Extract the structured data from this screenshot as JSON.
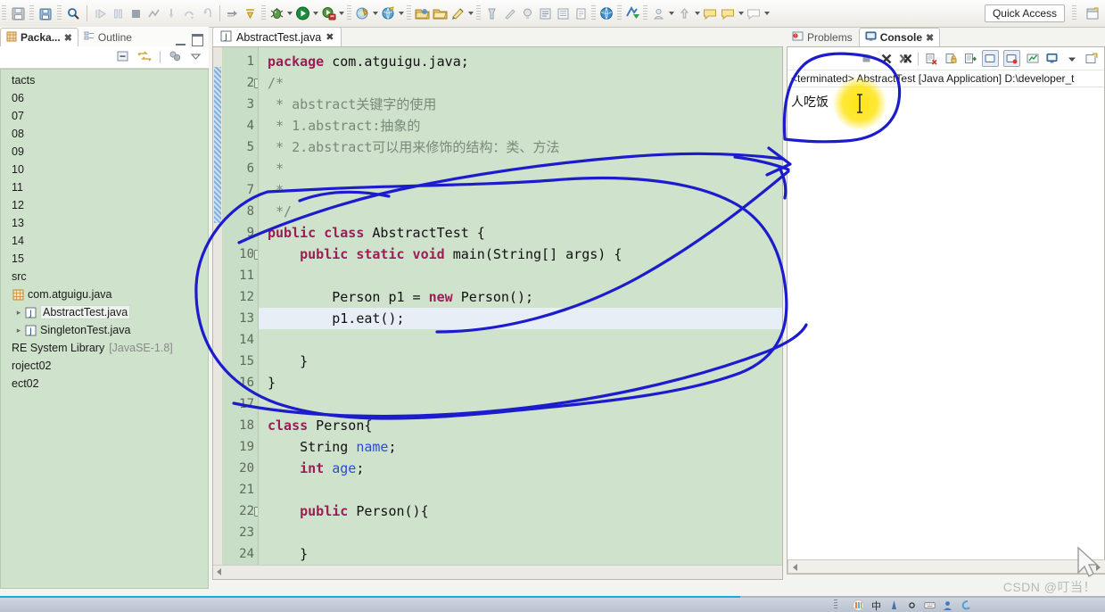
{
  "toolbar": {
    "quick_access_label": "Quick Access",
    "items": [
      {
        "name": "save-icon",
        "glyph": "▤"
      },
      {
        "name": "save-all-icon",
        "glyph": "▥"
      },
      {
        "name": "search-icon",
        "glyph": "⌕"
      },
      {
        "name": "resume-icon",
        "glyph": "▷"
      },
      {
        "name": "suspend-icon",
        "glyph": "‖"
      },
      {
        "name": "terminate-icon",
        "glyph": "■"
      },
      {
        "name": "disconnect-icon",
        "glyph": "⤨"
      },
      {
        "name": "step-into-icon",
        "glyph": "↓"
      },
      {
        "name": "step-over-icon",
        "glyph": "↷"
      },
      {
        "name": "step-return-icon",
        "glyph": "↰"
      },
      {
        "name": "next-annotation-icon",
        "glyph": "↦"
      },
      {
        "name": "previous-annotation-icon",
        "glyph": "↤"
      },
      {
        "name": "debug-icon",
        "glyph": "⚙"
      },
      {
        "name": "run-icon",
        "glyph": "▶"
      },
      {
        "name": "coverage-icon",
        "glyph": "◉"
      },
      {
        "name": "external-tools-icon",
        "glyph": "◔"
      },
      {
        "name": "search-globe-icon",
        "glyph": "○"
      },
      {
        "name": "open-type-icon",
        "glyph": "☰"
      },
      {
        "name": "open-task-icon",
        "glyph": "▱"
      },
      {
        "name": "new-java-project-icon",
        "glyph": "◪"
      },
      {
        "name": "new-package-icon",
        "glyph": "◫"
      },
      {
        "name": "new-class-icon",
        "glyph": "◬"
      },
      {
        "name": "javadoc-icon",
        "glyph": "ⓘ"
      },
      {
        "name": "browser-icon",
        "glyph": "●"
      },
      {
        "name": "perspective-icon",
        "glyph": "❖"
      },
      {
        "name": "back-icon",
        "glyph": "⇦"
      },
      {
        "name": "forward-icon",
        "glyph": "⇨"
      },
      {
        "name": "pin-icon",
        "glyph": "⚐"
      }
    ]
  },
  "sidebar": {
    "tab_active": "Packa...",
    "tab_inactive": "Outline",
    "close_glyph": "✖",
    "toolbar_icons": [
      "collapse-all-icon",
      "link-with-editor-icon",
      "view-menu-icon",
      "view-dropdown-icon"
    ],
    "tree": [
      {
        "label": "tacts",
        "indent": 0,
        "icon": "",
        "twist": ""
      },
      {
        "label": "06",
        "indent": 0,
        "icon": "",
        "twist": ""
      },
      {
        "label": "07",
        "indent": 0,
        "icon": "",
        "twist": ""
      },
      {
        "label": "08",
        "indent": 0,
        "icon": "",
        "twist": ""
      },
      {
        "label": "09",
        "indent": 0,
        "icon": "",
        "twist": ""
      },
      {
        "label": "10",
        "indent": 0,
        "icon": "",
        "twist": ""
      },
      {
        "label": "11",
        "indent": 0,
        "icon": "",
        "twist": ""
      },
      {
        "label": "12",
        "indent": 0,
        "icon": "",
        "twist": ""
      },
      {
        "label": "13",
        "indent": 0,
        "icon": "",
        "twist": ""
      },
      {
        "label": "14",
        "indent": 0,
        "icon": "",
        "twist": ""
      },
      {
        "label": "15",
        "indent": 0,
        "icon": "",
        "twist": ""
      },
      {
        "label": "src",
        "indent": 0,
        "icon": "",
        "twist": ""
      },
      {
        "label": "com.atguigu.java",
        "indent": 0,
        "icon": "package-icon",
        "twist": ""
      },
      {
        "label": "AbstractTest.java",
        "indent": 1,
        "icon": "java-file-icon",
        "twist": "▸",
        "selected": true
      },
      {
        "label": "SingletonTest.java",
        "indent": 1,
        "icon": "java-file-icon",
        "twist": "▸"
      },
      {
        "label": "RE System Library",
        "indent": 0,
        "icon": "",
        "twist": "",
        "dim": "[JavaSE-1.8]"
      },
      {
        "label": "roject02",
        "indent": 0,
        "icon": "",
        "twist": ""
      },
      {
        "label": "ect02",
        "indent": 0,
        "icon": "",
        "twist": ""
      }
    ]
  },
  "editor": {
    "tab_title": "AbstractTest.java",
    "tab_icon": "java-file-icon",
    "close_glyph": "✖",
    "lines": [
      {
        "n": "1",
        "fold": "",
        "tokens": [
          {
            "t": "package",
            "c": "kw"
          },
          {
            "t": " com.atguigu.java;",
            "c": "pln"
          }
        ]
      },
      {
        "n": "2",
        "fold": "-",
        "tokens": [
          {
            "t": "/*",
            "c": "cmt"
          }
        ]
      },
      {
        "n": "3",
        "fold": "",
        "tokens": [
          {
            "t": " * abstract关键字的使用",
            "c": "cmt"
          }
        ]
      },
      {
        "n": "4",
        "fold": "",
        "tokens": [
          {
            "t": " * 1.abstract:抽象的",
            "c": "cmt"
          }
        ]
      },
      {
        "n": "5",
        "fold": "",
        "tokens": [
          {
            "t": " * 2.abstract可以用来修饰的结构：类、方法",
            "c": "cmt"
          }
        ]
      },
      {
        "n": "6",
        "fold": "",
        "tokens": [
          {
            "t": " *",
            "c": "cmt"
          }
        ]
      },
      {
        "n": "7",
        "fold": "",
        "tokens": [
          {
            "t": " *",
            "c": "cmt"
          }
        ]
      },
      {
        "n": "8",
        "fold": "",
        "tokens": [
          {
            "t": " */",
            "c": "cmt"
          }
        ]
      },
      {
        "n": "9",
        "fold": "",
        "tokens": [
          {
            "t": "public class",
            "c": "kw"
          },
          {
            "t": " AbstractTest {",
            "c": "pln"
          }
        ]
      },
      {
        "n": "10",
        "fold": "-",
        "tokens": [
          {
            "t": "    ",
            "c": "pln"
          },
          {
            "t": "public static void",
            "c": "kw"
          },
          {
            "t": " main(String[] args) {",
            "c": "pln"
          }
        ]
      },
      {
        "n": "11",
        "fold": "",
        "tokens": [
          {
            "t": "",
            "c": "pln"
          }
        ]
      },
      {
        "n": "12",
        "fold": "",
        "tokens": [
          {
            "t": "        Person p1 = ",
            "c": "pln"
          },
          {
            "t": "new",
            "c": "kw"
          },
          {
            "t": " Person();",
            "c": "pln"
          }
        ]
      },
      {
        "n": "13",
        "fold": "",
        "highlight": true,
        "tokens": [
          {
            "t": "        p1.eat();",
            "c": "pln"
          }
        ]
      },
      {
        "n": "14",
        "fold": "",
        "tokens": [
          {
            "t": "",
            "c": "pln"
          }
        ]
      },
      {
        "n": "15",
        "fold": "",
        "tokens": [
          {
            "t": "    }",
            "c": "pln"
          }
        ]
      },
      {
        "n": "16",
        "fold": "",
        "tokens": [
          {
            "t": "}",
            "c": "pln"
          }
        ]
      },
      {
        "n": "17",
        "fold": "",
        "tokens": [
          {
            "t": "",
            "c": "pln"
          }
        ]
      },
      {
        "n": "18",
        "fold": "",
        "tokens": [
          {
            "t": "class",
            "c": "kw"
          },
          {
            "t": " Person{",
            "c": "pln"
          }
        ]
      },
      {
        "n": "19",
        "fold": "",
        "tokens": [
          {
            "t": "    String ",
            "c": "pln"
          },
          {
            "t": "name",
            "c": "fld"
          },
          {
            "t": ";",
            "c": "pln"
          }
        ]
      },
      {
        "n": "20",
        "fold": "",
        "tokens": [
          {
            "t": "    ",
            "c": "pln"
          },
          {
            "t": "int",
            "c": "kw"
          },
          {
            "t": " ",
            "c": "pln"
          },
          {
            "t": "age",
            "c": "fld"
          },
          {
            "t": ";",
            "c": "pln"
          }
        ]
      },
      {
        "n": "21",
        "fold": "",
        "tokens": [
          {
            "t": "",
            "c": "pln"
          }
        ]
      },
      {
        "n": "22",
        "fold": "-",
        "tokens": [
          {
            "t": "    ",
            "c": "pln"
          },
          {
            "t": "public",
            "c": "kw"
          },
          {
            "t": " Person(){",
            "c": "pln"
          }
        ]
      },
      {
        "n": "23",
        "fold": "",
        "tokens": [
          {
            "t": "",
            "c": "pln"
          }
        ]
      },
      {
        "n": "24",
        "fold": "",
        "tokens": [
          {
            "t": "    }",
            "c": "pln"
          }
        ]
      }
    ]
  },
  "console": {
    "tab_problems": "Problems",
    "tab_console": "Console",
    "close_glyph": "✖",
    "launch_line": "<terminated> AbstractTest [Java Application] D:\\developer_t",
    "output": "人吃饭",
    "toolbar_icons": [
      "terminate-icon",
      "remove-launch-icon",
      "remove-all-launches-icon",
      "clear-console-icon",
      "lock-scroll-icon",
      "show-console-on-output-icon",
      "display-selected-console-icon",
      "pin-console-icon",
      "open-console-icon",
      "console-dropdown-icon",
      "new-console-view-icon"
    ]
  },
  "status": {
    "watermark": "CSDN @叮当！",
    "progress_percent": 67
  }
}
